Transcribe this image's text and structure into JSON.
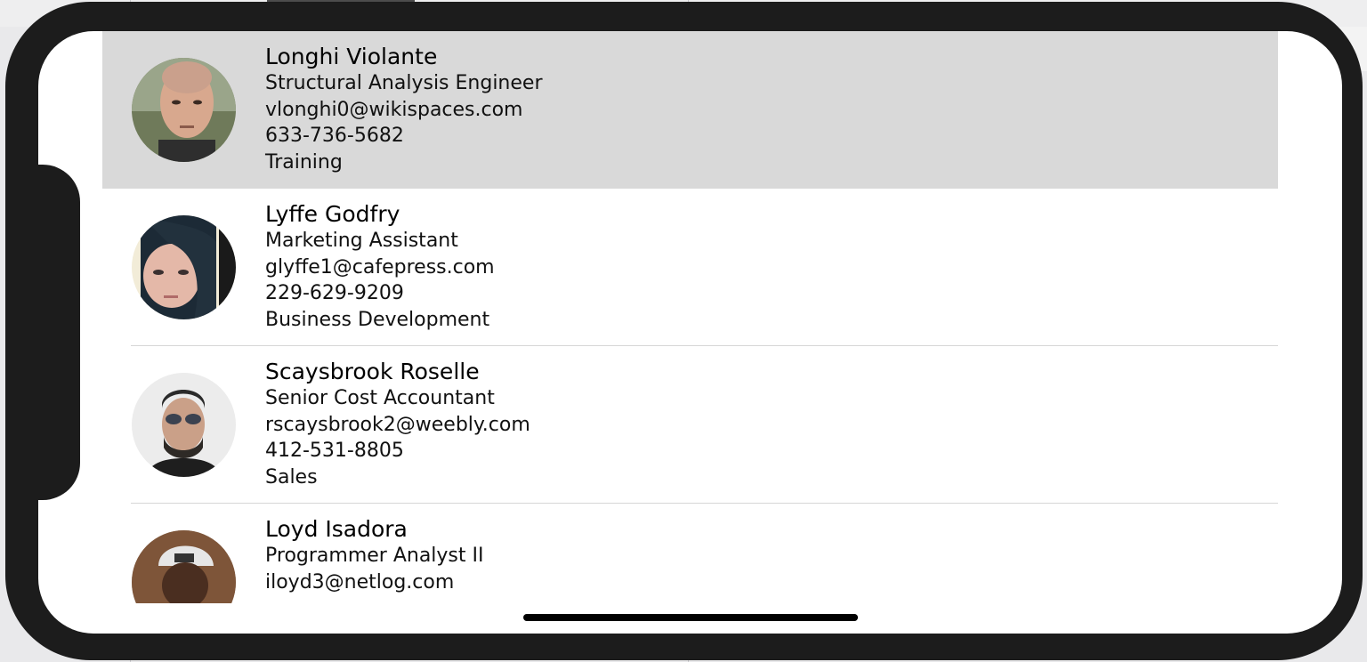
{
  "contacts": [
    {
      "name": "Longhi Violante",
      "title": "Structural Analysis Engineer",
      "email": "vlonghi0@wikispaces.com",
      "phone": "633-736-5682",
      "department": "Training",
      "selected": true
    },
    {
      "name": "Lyffe Godfry",
      "title": "Marketing Assistant",
      "email": "glyffe1@cafepress.com",
      "phone": "229-629-9209",
      "department": "Business Development",
      "selected": false
    },
    {
      "name": "Scaysbrook Roselle",
      "title": "Senior Cost Accountant",
      "email": "rscaysbrook2@weebly.com",
      "phone": "412-531-8805",
      "department": "Sales",
      "selected": false
    },
    {
      "name": "Loyd Isadora",
      "title": "Programmer Analyst II",
      "email": "iloyd3@netlog.com",
      "phone": "",
      "department": "",
      "selected": false
    }
  ],
  "colors": {
    "selected_row": "#d9d9d9",
    "separator": "#d6d6d6",
    "phone_frame": "#1c1c1c"
  }
}
